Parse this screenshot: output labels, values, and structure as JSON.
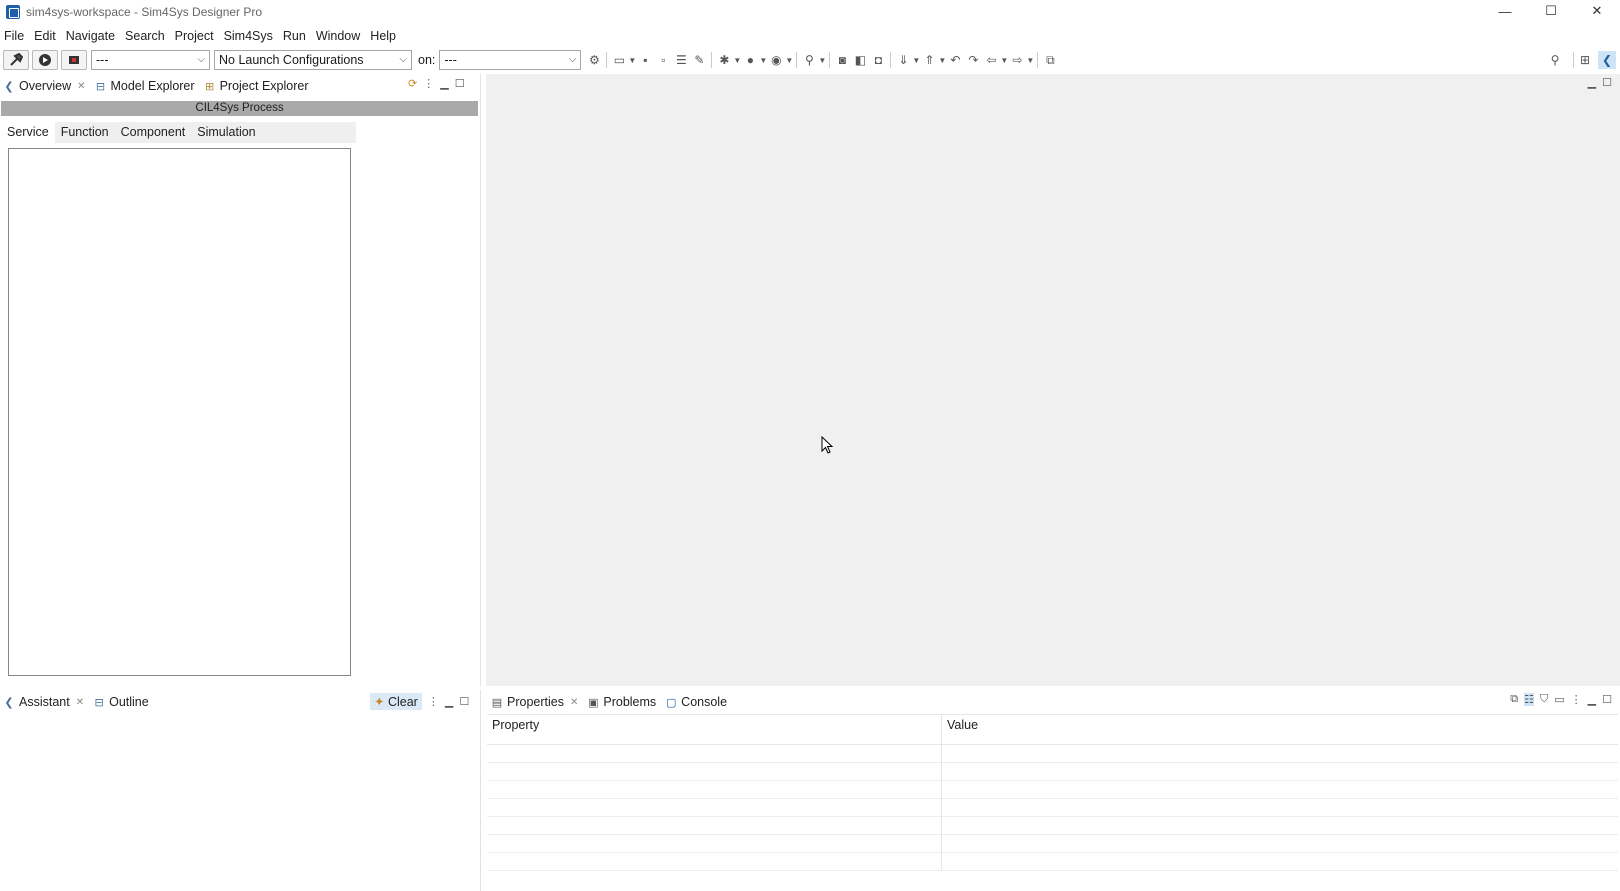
{
  "window": {
    "title": "sim4sys-workspace - Sim4Sys Designer Pro",
    "minimize_glyph": "—",
    "maximize_glyph": "☐",
    "close_glyph": "✕"
  },
  "menu": [
    "File",
    "Edit",
    "Navigate",
    "Search",
    "Project",
    "Sim4Sys",
    "Run",
    "Window",
    "Help"
  ],
  "toolbar": {
    "mode_combo": "---",
    "launch_combo": "No Launch Configurations",
    "on_label": "on:",
    "target_combo": "---"
  },
  "left_top_view": {
    "tabs": [
      {
        "label": "Overview",
        "icon": "overview-icon",
        "active": true
      },
      {
        "label": "Model Explorer",
        "icon": "model-explorer-icon",
        "active": false
      },
      {
        "label": "Project Explorer",
        "icon": "project-explorer-icon",
        "active": false
      }
    ],
    "process_title": "CIL4Sys Process",
    "subtabs": [
      "Service",
      "Function",
      "Component",
      "Simulation"
    ],
    "active_subtab": "Service"
  },
  "left_bottom_view": {
    "tabs": [
      {
        "label": "Assistant",
        "icon": "assistant-icon",
        "active": true
      },
      {
        "label": "Outline",
        "icon": "outline-icon",
        "active": false
      }
    ],
    "clear_label": "Clear"
  },
  "bottom_view": {
    "tabs": [
      {
        "label": "Properties",
        "icon": "properties-icon",
        "active": true
      },
      {
        "label": "Problems",
        "icon": "problems-icon",
        "active": false
      },
      {
        "label": "Console",
        "icon": "console-icon",
        "active": false
      }
    ],
    "columns": [
      "Property",
      "Value"
    ]
  },
  "colors": {
    "accent": "#1f5fa8",
    "process_bar": "#a9a9a9",
    "editor_bg": "#f0f0f0"
  }
}
